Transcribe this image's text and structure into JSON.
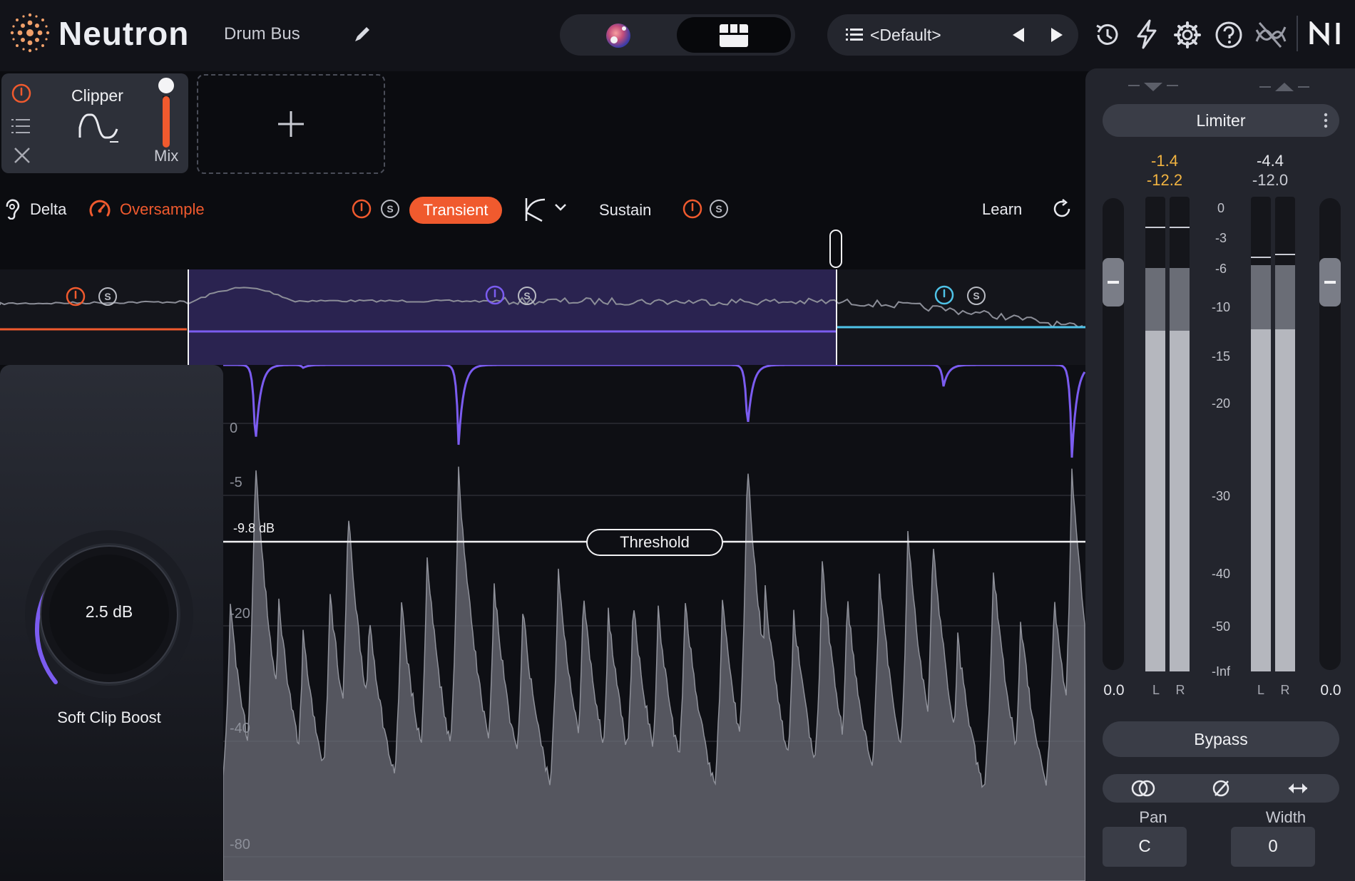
{
  "app": {
    "name": "Neutron",
    "preset_name": "Drum Bus"
  },
  "header": {
    "preset_selector": "<Default>"
  },
  "module": {
    "name": "Clipper",
    "mix_label": "Mix"
  },
  "controls": {
    "delta_label": "Delta",
    "oversample_label": "Oversample",
    "transient_label": "Transient",
    "sustain_label": "Sustain",
    "learn_label": "Learn",
    "solo_glyph": "S"
  },
  "graph": {
    "db_labels": [
      "0",
      "-5",
      "-20",
      "-40",
      "-80"
    ],
    "threshold_value": "-9.8 dB",
    "threshold_label": "Threshold"
  },
  "knob": {
    "value": "2.5 dB",
    "caption": "Soft Clip Boost"
  },
  "limiter": {
    "label": "Limiter",
    "left_peak": "-1.4",
    "left_rms": "-12.2",
    "right_peak": "-4.4",
    "right_rms": "-12.0",
    "scale": [
      "0",
      "-3",
      "-6",
      "-10",
      "-15",
      "-20",
      "-30",
      "-40",
      "-50",
      "-Inf"
    ],
    "input_gain": "0.0",
    "output_gain": "0.0",
    "ch_l": "L",
    "ch_r": "R",
    "bypass_label": "Bypass",
    "pan_label": "Pan",
    "width_label": "Width",
    "pan_value": "C",
    "width_value": "0"
  },
  "colors": {
    "accent_orange": "#f05a2e",
    "band_purple": "#7b5cf0",
    "band_cyan": "#4fc3e8",
    "warn_yellow": "#f2b441"
  }
}
